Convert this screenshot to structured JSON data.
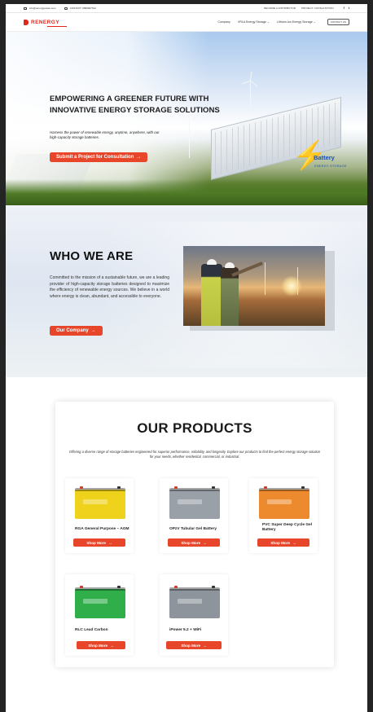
{
  "topbar": {
    "email": "info@renergypower.com",
    "phone": "CONTACT: 9689827612",
    "links": [
      "BECOME A DISTRIBUTOR",
      "PROJECT CONSULTATION"
    ],
    "social": [
      "f",
      "t"
    ]
  },
  "nav": {
    "logo": "RENERGY",
    "items": [
      {
        "label": "Company",
        "dropdown": false
      },
      {
        "label": "VRLA Energy Storage",
        "dropdown": true
      },
      {
        "label": "Lithium-Ion Energy Storage",
        "dropdown": true
      }
    ],
    "contact_label": "CONTACT US"
  },
  "hero": {
    "title": "EMPOWERING A GREENER FUTURE WITH INNOVATIVE ENERGY STORAGE SOLUTIONS",
    "subtitle": "Harness the power of renewable energy, anytime, anywhere, with our high-capacity storage batteries.",
    "cta_label": "Submit a Project for Consultation",
    "arrow": "→",
    "container_title": "Battery",
    "container_sub": "ENERGY STORAGE"
  },
  "who": {
    "title": "WHO WE ARE",
    "text": "Committed to the mission of a sustainable future, we are a leading provider of high-capacity storage batteries designed to maximize the efficiency of renewable energy sources. We believe in a world where energy is clean, abundant, and accessible to everyone.",
    "cta_label": "Our Company",
    "arrow": "→"
  },
  "products": {
    "title": "OUR PRODUCTS",
    "intro": "Offering a diverse range of storage batteries engineered for superior performance, reliability, and longevity. Explore our products to find the perfect energy storage solution for your needs, whether residential, commercial, or industrial.",
    "shop_label": "Shop More",
    "arrow": "→",
    "items": [
      {
        "name": "RGA General Purpose – AGM",
        "color": "#efd21b"
      },
      {
        "name": "OPzV Tubular Gel Battery",
        "color": "#9aa0a8"
      },
      {
        "name": "PVC Super Deep Cycle Gel Battery",
        "color": "#ee8a2e"
      },
      {
        "name": "RLC Lead Carbon",
        "color": "#2fae4a"
      },
      {
        "name": "iPower 5.2 + WiFi",
        "color": "#8d949c"
      }
    ]
  },
  "colors": {
    "accent": "#e8462a",
    "brand": "#e2261d",
    "battery_blue": "#1d4fb5"
  }
}
